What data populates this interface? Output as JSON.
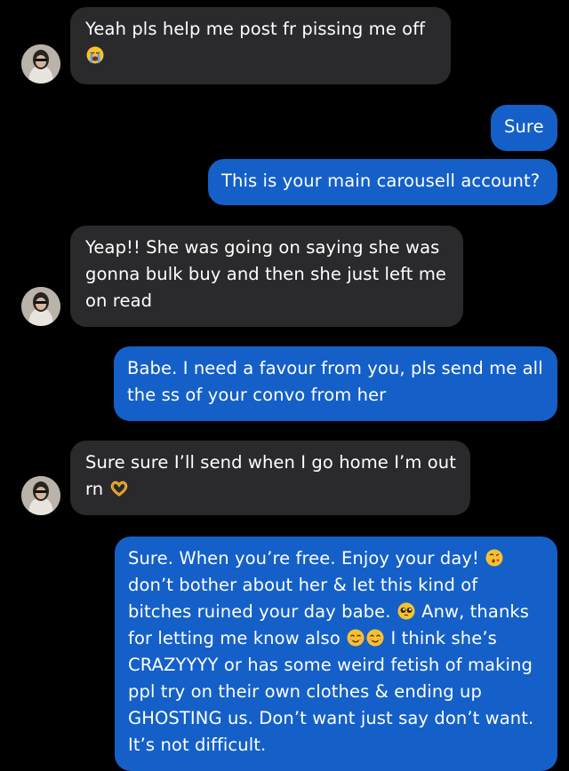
{
  "chat": {
    "messages": [
      {
        "direction": "incoming",
        "text": "Yeah pls help me post fr pissing me off",
        "emoji": "loudly-crying-face"
      },
      {
        "direction": "outgoing",
        "text": "Sure"
      },
      {
        "direction": "outgoing",
        "text": "This is your main carousell account?"
      },
      {
        "direction": "incoming",
        "lines": [
          "Yeap!! She was going on saying she was",
          "gonna bulk buy and then she just left me",
          "on read"
        ]
      },
      {
        "direction": "outgoing",
        "lines": [
          "Babe. I need a favour from you, pls send me all",
          "the ss of your convo from her"
        ]
      },
      {
        "direction": "incoming",
        "lines": [
          "Sure sure I’ll send when I go home I’m out",
          "rn"
        ],
        "emoji": "heart-hands"
      },
      {
        "direction": "outgoing",
        "parts": {
          "l1": "Sure. When you’re free. Enjoy your day!",
          "l2": "don’t bother about her & let this kind of",
          "l3a": "bitches ruined your day babe.",
          "l3b": "Anw, thanks",
          "l4a": "for letting me know also",
          "l4b": "I think she’s",
          "l5": "CRAZYYYY or has some weird fetish of making",
          "l6": "ppl try on their own clothes & ending up",
          "l7": "GHOSTING us. Don’t want just say don’t want.",
          "l8": "It’s not difficult."
        },
        "emojis": [
          "face-blowing-a-kiss",
          "pleading-face",
          "smiling-face-with-smiling-eyes",
          "smiling-face-with-smiling-eyes"
        ]
      }
    ],
    "avatar_icon": "contact-avatar"
  },
  "colors": {
    "background": "#000000",
    "incoming_bubble": "#2a2a2c",
    "outgoing_bubble": "#1460c8",
    "text": "#ffffff"
  }
}
